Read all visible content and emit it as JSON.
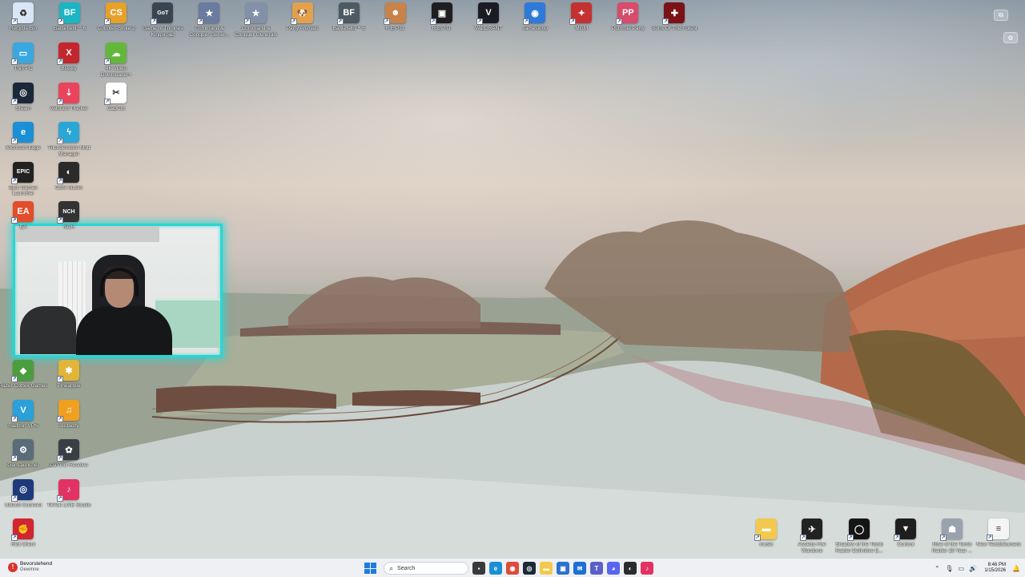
{
  "desktop": {
    "icons_top_row": [
      {
        "label": "Recycle Bin",
        "icon": "recycle-bin-icon",
        "color": "#d8e6f5",
        "glyph": "♻"
      },
      {
        "label": "Battlefield™ 6",
        "icon": "battlefield-icon",
        "color": "#1bb5c4",
        "glyph": "BF"
      },
      {
        "label": "Counter-Strike 2",
        "icon": "counter-strike-icon",
        "color": "#e7a029",
        "glyph": "CS"
      },
      {
        "label": "Game of Thrones Kingsroad",
        "icon": "got-icon",
        "color": "#3b4552",
        "glyph": "GoT"
      },
      {
        "label": "Command & Conquer Gener...",
        "icon": "cnc-icon",
        "color": "#6a7ba0",
        "glyph": "★"
      },
      {
        "label": "Command & Conquer Generals",
        "icon": "cnc-generals-icon",
        "color": "#8391a8",
        "glyph": "★"
      },
      {
        "label": "Party Animals",
        "icon": "party-animals-icon",
        "color": "#e3a14e",
        "glyph": "🐶"
      },
      {
        "label": "Battlefield™ 6",
        "icon": "battlefield-icon",
        "color": "#4e5a62",
        "glyph": "BF"
      },
      {
        "label": "R.E.P.O.",
        "icon": "ai-there-yet-icon",
        "color": "#c7834a",
        "glyph": "☻"
      },
      {
        "label": "R.E.P.O.",
        "icon": "repo-icon",
        "color": "#1f1f1f",
        "glyph": "▣"
      },
      {
        "label": "VALORANT",
        "icon": "valorant-icon",
        "color": "#1b1b24",
        "glyph": "V"
      },
      {
        "label": "Jamesloop",
        "icon": "jamesloop-icon",
        "color": "#2f79d8",
        "glyph": "◉"
      },
      {
        "label": "MGM",
        "icon": "mgm-icon",
        "color": "#c53131",
        "glyph": "✦"
      },
      {
        "label": "Pummel Party",
        "icon": "pummel-party-icon",
        "color": "#d84b6b",
        "glyph": "PP"
      },
      {
        "label": "Sons Of The Forest",
        "icon": "sons-forest-icon",
        "color": "#7a1217",
        "glyph": "✚"
      }
    ],
    "icons_left_col1": [
      {
        "label": "This PC",
        "icon": "this-pc-icon",
        "color": "#39a8de",
        "glyph": "▭"
      },
      {
        "label": "Steam",
        "icon": "steam-icon",
        "color": "#1b2838",
        "glyph": "◎"
      },
      {
        "label": "Microsoft Edge",
        "icon": "edge-icon",
        "color": "#1a8fd6",
        "glyph": "e"
      },
      {
        "label": "Epic Games Launcher",
        "icon": "epic-games-icon",
        "color": "#222222",
        "glyph": "EPIC"
      },
      {
        "label": "EA",
        "icon": "ea-icon",
        "color": "#e24d2b",
        "glyph": "EA"
      }
    ],
    "icons_left_col2": [
      {
        "label": "Blasky",
        "icon": "blasky-icon",
        "color": "#c4262e",
        "glyph": "X"
      },
      {
        "label": "Valorant Tracker",
        "icon": "valorant-tracker-icon",
        "color": "#e9445c",
        "glyph": "⇣"
      },
      {
        "label": "Thunderstore Mod Manager",
        "icon": "thunderstore-icon",
        "color": "#2aa7d6",
        "glyph": "ϟ"
      },
      {
        "label": "OBS Studio",
        "icon": "obs-icon",
        "color": "#2b2b2b",
        "glyph": "◐"
      },
      {
        "label": "NCH",
        "icon": "nch-icon",
        "color": "#333333",
        "glyph": "NCH"
      }
    ],
    "icons_left_col3": [
      {
        "label": "4K Video Downloader+",
        "icon": "4k-downloader-icon",
        "color": "#63b83a",
        "glyph": "☁"
      },
      {
        "label": "CapCut",
        "icon": "capcut-icon",
        "color": "#ffffff",
        "glyph": "✂"
      }
    ],
    "icons_left_bottom_col1": [
      {
        "label": "Razer Cortex Games",
        "icon": "razer-cortex-icon",
        "color": "#4b9e3d",
        "glyph": "◆"
      },
      {
        "label": "Radmin VPN",
        "icon": "radmin-vpn-icon",
        "color": "#2ba0d9",
        "glyph": "V"
      },
      {
        "label": "GenLauncher",
        "icon": "genlauncher-icon",
        "color": "#5a6b7a",
        "glyph": "⚙"
      },
      {
        "label": "Ubisoft Connect",
        "icon": "ubisoft-icon",
        "color": "#1f3a7a",
        "glyph": "◎"
      },
      {
        "label": "Riot Client",
        "icon": "riot-client-icon",
        "color": "#d1252f",
        "glyph": "✊"
      }
    ],
    "icons_left_bottom_col2": [
      {
        "label": "Pineapple",
        "icon": "pineapple-icon",
        "color": "#e0b53a",
        "glyph": "✱"
      },
      {
        "label": "Audacity",
        "icon": "audacity-icon",
        "color": "#f0a020",
        "glyph": "♫"
      },
      {
        "label": "DaVinci Resolve",
        "icon": "davinci-icon",
        "color": "#3a3f46",
        "glyph": "✿"
      },
      {
        "label": "TikTok LIVE Studio",
        "icon": "tiktok-live-icon",
        "color": "#e23262",
        "glyph": "♪"
      }
    ],
    "icons_bottom_right": [
      {
        "label": "music",
        "icon": "folder-icon",
        "color": "#f2c94c",
        "glyph": "▬"
      },
      {
        "label": "Assetto Fire Wardone",
        "icon": "assetto-icon",
        "color": "#222222",
        "glyph": "✈"
      },
      {
        "label": "Shadow of the Tomb Raider Definitive E...",
        "icon": "shadow-tomb-raider-icon",
        "color": "#151515",
        "glyph": "◯"
      },
      {
        "label": "Control",
        "icon": "control-icon",
        "color": "#1e1e1e",
        "glyph": "▼"
      },
      {
        "label": "Rise of the Tomb Raider 20 Year ...",
        "icon": "rise-tomb-raider-icon",
        "color": "#9aa3ad",
        "glyph": "☗"
      },
      {
        "label": "New Textdokument",
        "icon": "text-document-icon",
        "color": "#f4f4f4",
        "glyph": "≡"
      }
    ]
  },
  "taskbar": {
    "weather_title": "Bevorstehend",
    "weather_sub": "Gewinne",
    "search_placeholder": "Search",
    "apps": [
      {
        "icon": "file-explorer-icon",
        "color": "#3a3a3a",
        "glyph": "▪"
      },
      {
        "icon": "edge-icon",
        "color": "#1a8fd6",
        "glyph": "e"
      },
      {
        "icon": "chrome-icon",
        "color": "#dd4b39",
        "glyph": "◉"
      },
      {
        "icon": "steam-icon",
        "color": "#1b2838",
        "glyph": "◎"
      },
      {
        "icon": "folder-icon",
        "color": "#f2c94c",
        "glyph": "▬"
      },
      {
        "icon": "app-icon",
        "color": "#2a6fd1",
        "glyph": "▣"
      },
      {
        "icon": "mail-icon",
        "color": "#1b6fd6",
        "glyph": "✉"
      },
      {
        "icon": "teams-icon",
        "color": "#5b5fc7",
        "glyph": "T"
      },
      {
        "icon": "discord-icon",
        "color": "#5865f2",
        "glyph": "◕"
      },
      {
        "icon": "obs-icon",
        "color": "#2b2b2b",
        "glyph": "◐"
      },
      {
        "icon": "tiktok-live-icon",
        "color": "#e23262",
        "glyph": "♪"
      }
    ],
    "clock_time": "8:46 PM",
    "clock_date": "1/15/2026"
  }
}
